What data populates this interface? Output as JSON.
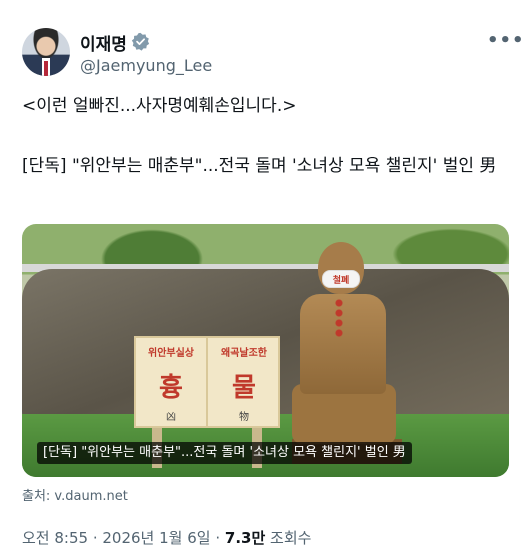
{
  "author": {
    "name": "이재명",
    "handle": "@Jaemyung_Lee"
  },
  "tweet": {
    "line1": "<이런 얼빠진...사자명예훼손입니다.>",
    "line2": "[단독] \"위안부는 매춘부\"...전국 돌며 '소녀상 모욕 챌린지' 벌인 男"
  },
  "media": {
    "sign_left_small": "위안부실상",
    "sign_left_big": "흉",
    "sign_left_hanja": "凶",
    "sign_right_small": "왜곡날조한",
    "sign_right_big": "물",
    "sign_right_hanja": "物",
    "mask_text": "철폐",
    "caption": "[단독] \"위안부는 매춘부\"...전국 돌며 '소녀상 모욕 챌린지' 벌인 男"
  },
  "source": "출처: v.daum.net",
  "meta": {
    "time": "오전 8:55",
    "sep1": " · ",
    "date": "2026년 1월 6일",
    "sep2": " · ",
    "views_count": "7.3만",
    "views_label": " 조회수"
  },
  "icons": [
    "verified-badge-icon",
    "more-options-icon"
  ],
  "colors": {
    "text": "#0f1419",
    "secondary": "#536471",
    "verified": "#829aab"
  }
}
